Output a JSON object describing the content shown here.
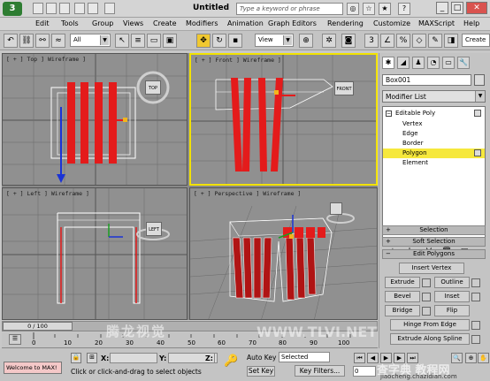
{
  "title_bar": {
    "app_logo": "3",
    "document_title": "Untitled",
    "search_placeholder": "Type a keyword or phrase"
  },
  "menu": [
    "Edit",
    "Tools",
    "Group",
    "Views",
    "Create",
    "Modifiers",
    "Animation",
    "Graph Editors",
    "Rendering",
    "Customize",
    "MAXScript",
    "Help"
  ],
  "toolbar": {
    "selection_filter": "All",
    "reference_coord": "View",
    "named_selection": "Create"
  },
  "viewports": [
    {
      "label": "[ + ] Top ] Wireframe ]",
      "navcube": "TOP"
    },
    {
      "label": "[ + ] Front ] Wireframe ]",
      "navcube": "FRONT"
    },
    {
      "label": "[ + ] Left ] Wireframe ]",
      "navcube": "LEFT"
    },
    {
      "label": "[ + ] Perspective ] Wireframe ]",
      "navcube": ""
    }
  ],
  "command_panel": {
    "object_name": "Box001",
    "modifier_list": "Modifier List",
    "stack": [
      {
        "label": "Editable Poly",
        "toggle": "−"
      },
      {
        "label": "Vertex"
      },
      {
        "label": "Edge"
      },
      {
        "label": "Border"
      },
      {
        "label": "Polygon",
        "selected": true
      },
      {
        "label": "Element"
      }
    ],
    "rollouts": {
      "selection": "Selection",
      "soft_selection": "Soft Selection",
      "edit_polygons": "Edit Polygons"
    },
    "buttons": {
      "insert_vertex": "Insert Vertex",
      "extrude": "Extrude",
      "outline": "Outline",
      "bevel": "Bevel",
      "inset": "Inset",
      "bridge": "Bridge",
      "flip": "Flip",
      "hinge": "Hinge From Edge",
      "extrude_spline": "Extrude Along Spline"
    },
    "rollout_signs": {
      "plus": "+",
      "minus": "−"
    }
  },
  "timeline": {
    "thumb": "0 / 100",
    "ticks": [
      "0",
      "10",
      "20",
      "30",
      "40",
      "50",
      "60",
      "70",
      "80",
      "90",
      "100"
    ]
  },
  "status": {
    "maxscript": "Welcome to MAX!",
    "prompt": "Click or click-and-drag to select objects",
    "x_label": "X:",
    "y_label": "Y:",
    "z_label": "Z:",
    "auto_key": "Auto Key",
    "set_key": "Set Key",
    "key_mode": "Selected",
    "key_filters": "Key Filters...",
    "frame": "0"
  },
  "watermarks": {
    "cn_text": "腾龙视觉",
    "site": "WWW.TLVI.NET",
    "logo_cn": "查字典 教程网",
    "logo_url": "jiaocheng.chazidian.com"
  },
  "colors": {
    "selected_poly": "#e41b1b",
    "active_viewport": "#f2e200",
    "stack_highlight": "#f6e83c"
  }
}
